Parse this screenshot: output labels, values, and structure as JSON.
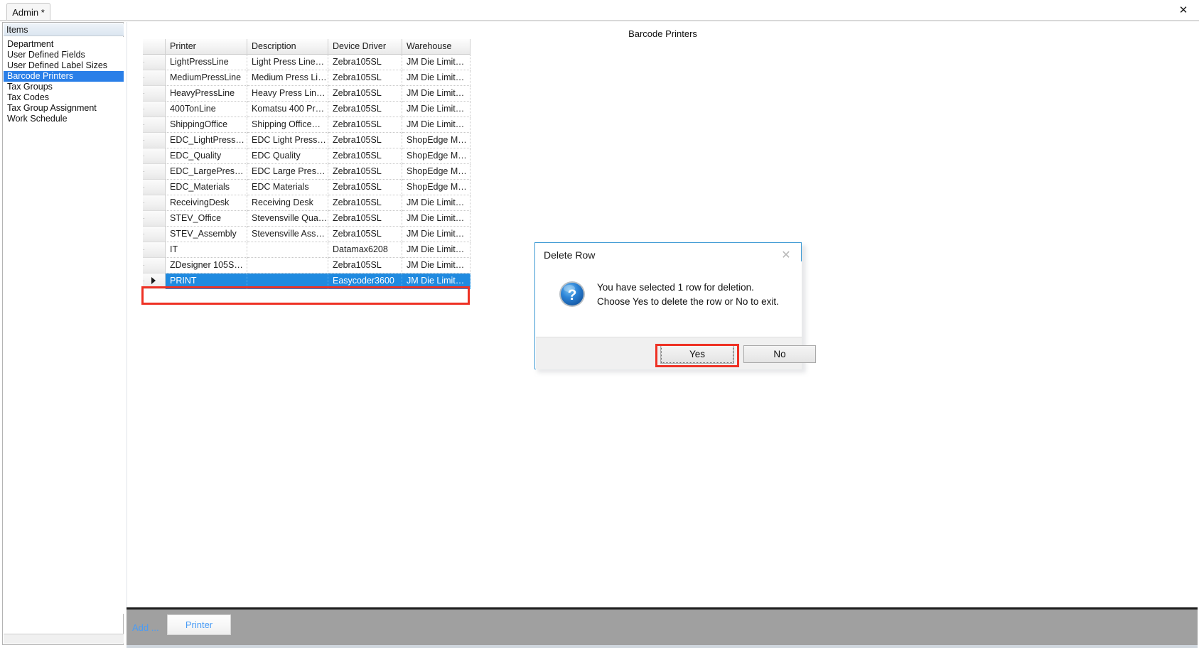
{
  "window": {
    "tab_label": "Admin *",
    "close_icon": "close-icon",
    "close_glyph": "✕"
  },
  "sidebar": {
    "header": "Items",
    "items": [
      {
        "label": "Department",
        "selected": false
      },
      {
        "label": "User Defined Fields",
        "selected": false
      },
      {
        "label": "User Defined Label Sizes",
        "selected": false
      },
      {
        "label": "Barcode Printers",
        "selected": true
      },
      {
        "label": "Tax Groups",
        "selected": false
      },
      {
        "label": "Tax Codes",
        "selected": false
      },
      {
        "label": "Tax Group Assignment",
        "selected": false
      },
      {
        "label": "Work Schedule",
        "selected": false
      }
    ]
  },
  "main": {
    "page_title": "Barcode Printers"
  },
  "grid": {
    "columns": [
      "Printer",
      "Description",
      "Device Driver",
      "Warehouse"
    ],
    "rows": [
      {
        "printer": "LightPressLine",
        "description": "Light Press Line…",
        "driver": "Zebra105SL",
        "warehouse": "JM Die Limit…",
        "selected": false
      },
      {
        "printer": "MediumPressLine",
        "description": "Medium Press Li…",
        "driver": "Zebra105SL",
        "warehouse": "JM Die Limit…",
        "selected": false
      },
      {
        "printer": "HeavyPressLine",
        "description": "Heavy Press Lin…",
        "driver": "Zebra105SL",
        "warehouse": "JM Die Limit…",
        "selected": false
      },
      {
        "printer": "400TonLine",
        "description": "Komatsu 400 Pr…",
        "driver": "Zebra105SL",
        "warehouse": "JM Die Limit…",
        "selected": false
      },
      {
        "printer": "ShippingOffice",
        "description": "Shipping Office…",
        "driver": "Zebra105SL",
        "warehouse": "JM Die Limit…",
        "selected": false
      },
      {
        "printer": "EDC_LightPress…",
        "description": "EDC Light Press…",
        "driver": "Zebra105SL",
        "warehouse": "ShopEdge  M…",
        "selected": false
      },
      {
        "printer": "EDC_Quality",
        "description": "EDC Quality",
        "driver": "Zebra105SL",
        "warehouse": "ShopEdge  M…",
        "selected": false
      },
      {
        "printer": "EDC_LargePres…",
        "description": "EDC Large Pres…",
        "driver": "Zebra105SL",
        "warehouse": "ShopEdge  M…",
        "selected": false
      },
      {
        "printer": "EDC_Materials",
        "description": "EDC Materials",
        "driver": "Zebra105SL",
        "warehouse": "ShopEdge  M…",
        "selected": false
      },
      {
        "printer": "ReceivingDesk",
        "description": "Receiving Desk",
        "driver": "Zebra105SL",
        "warehouse": "JM Die Limit…",
        "selected": false
      },
      {
        "printer": "STEV_Office",
        "description": "Stevensville Qua…",
        "driver": "Zebra105SL",
        "warehouse": "JM Die Limit…",
        "selected": false
      },
      {
        "printer": "STEV_Assembly",
        "description": "Stevensville Ass…",
        "driver": "Zebra105SL",
        "warehouse": "JM Die Limit…",
        "selected": false
      },
      {
        "printer": "IT",
        "description": "",
        "driver": "Datamax6208",
        "warehouse": "JM Die Limit…",
        "selected": false
      },
      {
        "printer": "ZDesigner  105S…",
        "description": "",
        "driver": "Zebra105SL",
        "warehouse": "JM Die Limit…",
        "selected": false
      },
      {
        "printer": "PRINT",
        "description": "",
        "driver": "Easycoder3600",
        "warehouse": "JM Die Limit…",
        "selected": true
      }
    ]
  },
  "toolbar": {
    "add_label": "Add ...",
    "printer_button": "Printer"
  },
  "dialog": {
    "title": "Delete Row",
    "close_glyph": "✕",
    "icon": "question-icon",
    "message_line1": "You have selected 1 row for deletion.",
    "message_line2": "Choose Yes to delete the row or No to exit.",
    "yes_label": "Yes",
    "no_label": "No"
  },
  "colors": {
    "accent_selection": "#1f8ae0",
    "annotation_red": "#ee3124",
    "link_blue": "#4a9cf5",
    "toolbar_gray": "#a0a0a0"
  }
}
